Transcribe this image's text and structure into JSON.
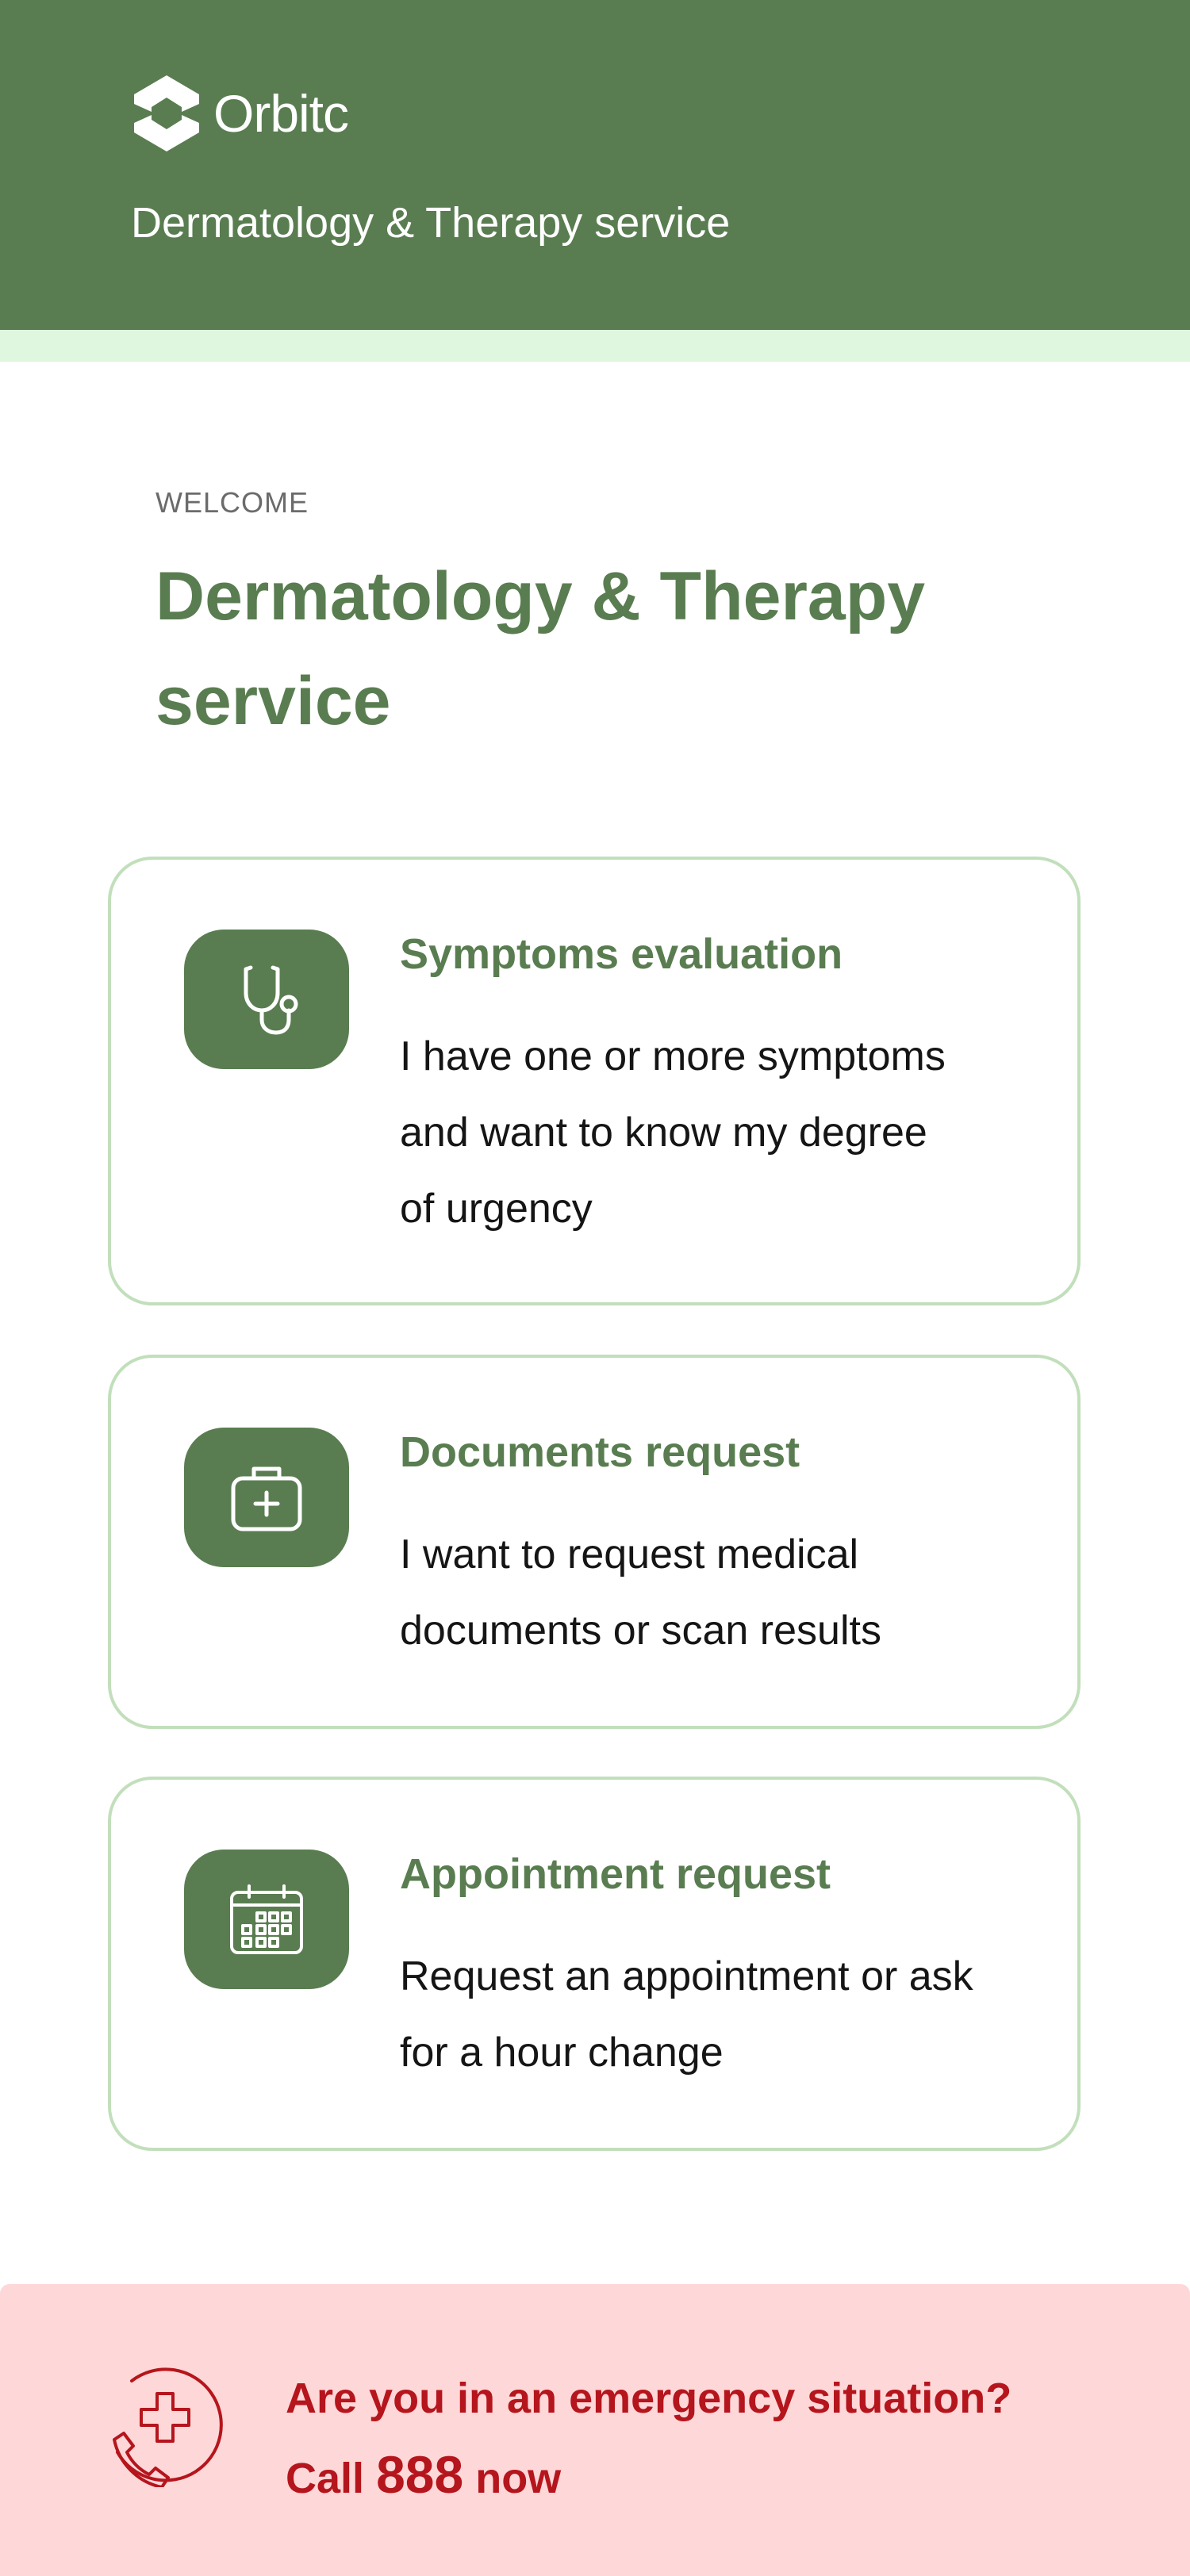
{
  "header": {
    "brand": "Orbitc",
    "subtitle": "Dermatology & Therapy service",
    "background_color": "#597d50",
    "strip_color": "#dff6df"
  },
  "welcome": {
    "label": "WELCOME",
    "title": "Dermatology & Therapy service"
  },
  "cards": [
    {
      "icon": "stethoscope-icon",
      "title": "Symptoms evaluation",
      "description_lines": [
        "I have one or more symptoms",
        "and want to know my degree",
        "of urgency"
      ]
    },
    {
      "icon": "medical-bag-icon",
      "title": "Documents request",
      "description_lines": [
        "I want to request medical",
        "documents or scan results"
      ]
    },
    {
      "icon": "calendar-icon",
      "title": "Appointment request",
      "description_lines": [
        "Request an appointment or ask",
        "for a hour change"
      ]
    }
  ],
  "emergency": {
    "icon": "emergency-phone-icon",
    "question": "Are you in an emergency situation?",
    "call_prefix": "Call",
    "number": "888",
    "call_suffix": "now",
    "background_color": "#fed7d8",
    "text_color": "#b5151c"
  },
  "colors": {
    "accent": "#597d50",
    "card_border": "#c2dfbb"
  }
}
